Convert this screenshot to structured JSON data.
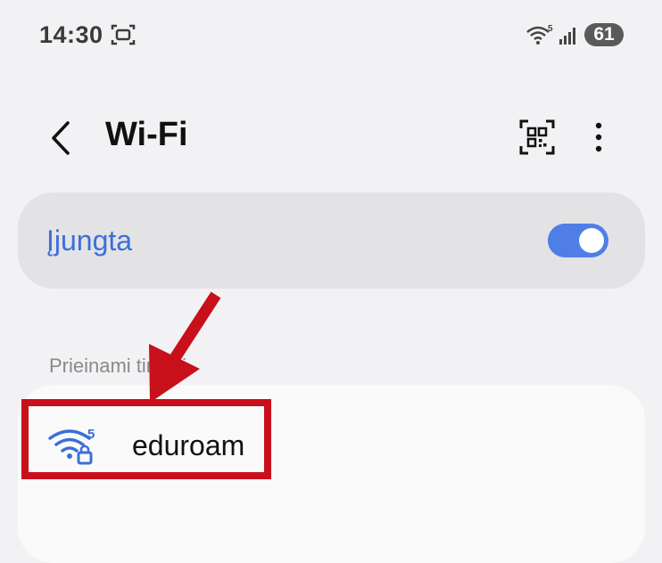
{
  "status_bar": {
    "time": "14:30",
    "wifi_band": "5",
    "battery": "61",
    "icons": [
      "screen-recorder-icon",
      "wifi-icon",
      "signal-icon",
      "battery-icon"
    ]
  },
  "header": {
    "title": "Wi-Fi",
    "icons": [
      "back-arrow-icon",
      "qr-code-icon",
      "more-vertical-icon"
    ]
  },
  "wifi_toggle": {
    "label": "Įjungta",
    "state": "on",
    "accent_color": "#4f7fe6"
  },
  "available_networks": {
    "header": "Prieinami tinklai",
    "networks": [
      {
        "name": "eduroam",
        "band": "5",
        "secured": true,
        "icon": "wifi-lock-icon"
      }
    ]
  },
  "annotation": {
    "color": "#c8101a",
    "highlight": "eduroam"
  }
}
